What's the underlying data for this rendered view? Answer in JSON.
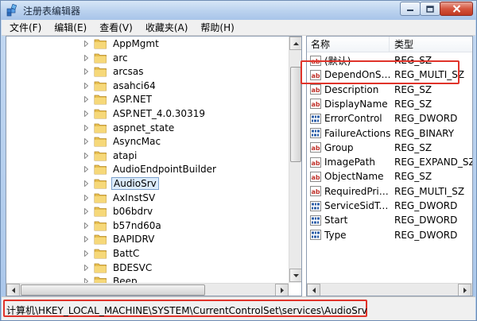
{
  "window": {
    "title": "注册表编辑器"
  },
  "menu": [
    {
      "id": "file",
      "label": "文件(F)"
    },
    {
      "id": "edit",
      "label": "编辑(E)"
    },
    {
      "id": "view",
      "label": "查看(V)"
    },
    {
      "id": "favorites",
      "label": "收藏夹(A)"
    },
    {
      "id": "help",
      "label": "帮助(H)"
    }
  ],
  "tree": {
    "items": [
      {
        "label": "AppMgmt",
        "expandable": true
      },
      {
        "label": "arc",
        "expandable": true
      },
      {
        "label": "arcsas",
        "expandable": true
      },
      {
        "label": "asahci64",
        "expandable": true
      },
      {
        "label": "ASP.NET",
        "expandable": true
      },
      {
        "label": "ASP.NET_4.0.30319",
        "expandable": true
      },
      {
        "label": "aspnet_state",
        "expandable": true
      },
      {
        "label": "AsyncMac",
        "expandable": true
      },
      {
        "label": "atapi",
        "expandable": true
      },
      {
        "label": "AudioEndpointBuilder",
        "expandable": true
      },
      {
        "label": "AudioSrv",
        "expandable": true,
        "selected": true
      },
      {
        "label": "AxInstSV",
        "expandable": true
      },
      {
        "label": "b06bdrv",
        "expandable": true
      },
      {
        "label": "b57nd60a",
        "expandable": true
      },
      {
        "label": "BAPIDRV",
        "expandable": true
      },
      {
        "label": "BattC",
        "expandable": true
      },
      {
        "label": "BDESVC",
        "expandable": true
      },
      {
        "label": "Beep",
        "expandable": true
      }
    ]
  },
  "values": {
    "header": {
      "name": "名称",
      "type": "类型"
    },
    "rows": [
      {
        "name": "(默认)",
        "type": "REG_SZ",
        "icon": "string-value-icon"
      },
      {
        "name": "DependOnServ...",
        "type": "REG_MULTI_SZ",
        "icon": "string-value-icon"
      },
      {
        "name": "Description",
        "type": "REG_SZ",
        "icon": "string-value-icon"
      },
      {
        "name": "DisplayName",
        "type": "REG_SZ",
        "icon": "string-value-icon"
      },
      {
        "name": "ErrorControl",
        "type": "REG_DWORD",
        "icon": "binary-value-icon"
      },
      {
        "name": "FailureActions",
        "type": "REG_BINARY",
        "icon": "binary-value-icon"
      },
      {
        "name": "Group",
        "type": "REG_SZ",
        "icon": "string-value-icon"
      },
      {
        "name": "ImagePath",
        "type": "REG_EXPAND_SZ",
        "icon": "string-value-icon"
      },
      {
        "name": "ObjectName",
        "type": "REG_SZ",
        "icon": "string-value-icon"
      },
      {
        "name": "RequiredPrivile...",
        "type": "REG_MULTI_SZ",
        "icon": "string-value-icon"
      },
      {
        "name": "ServiceSidType",
        "type": "REG_DWORD",
        "icon": "binary-value-icon"
      },
      {
        "name": "Start",
        "type": "REG_DWORD",
        "icon": "binary-value-icon"
      },
      {
        "name": "Type",
        "type": "REG_DWORD",
        "icon": "binary-value-icon"
      }
    ]
  },
  "status": {
    "path": "计算机\\HKEY_LOCAL_MACHINE\\SYSTEM\\CurrentControlSet\\services\\AudioSrv"
  },
  "colors": {
    "highlight": "#e0332a",
    "selection": "#dcecfc",
    "titlebar": "#bcd3ef"
  }
}
